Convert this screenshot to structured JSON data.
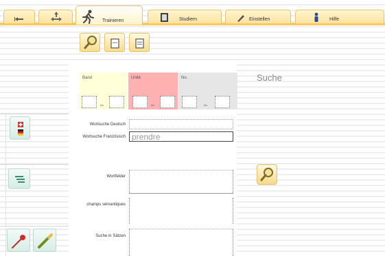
{
  "tabs": [
    {
      "id": "back",
      "label": "",
      "icon": "back-arrow-icon"
    },
    {
      "id": "move",
      "label": "",
      "icon": "move-arrows-icon"
    },
    {
      "id": "trainieren",
      "label": "Trainieren",
      "icon": "running-figure-icon",
      "active": true
    },
    {
      "id": "studieren",
      "label": "Studiern",
      "icon": "book-icon"
    },
    {
      "id": "einstellen",
      "label": "Einstellen",
      "icon": "pen-icon"
    },
    {
      "id": "hilfe",
      "label": "Hilfe",
      "icon": "info-icon"
    }
  ],
  "subtoolbar": [
    {
      "id": "search",
      "icon": "magnifier-icon"
    },
    {
      "id": "card",
      "icon": "card-icon"
    },
    {
      "id": "list",
      "icon": "list-icon"
    }
  ],
  "columns": [
    {
      "label": "Band",
      "color": "#ffffd8"
    },
    {
      "label": "Unité",
      "color": "#ffb0b0"
    },
    {
      "label": "No.",
      "color": "#e6e6e6"
    }
  ],
  "bis_label": "bis",
  "labels": {
    "wortsuche_deutsch": "Wortsuche Deutsch",
    "wortsuche_franzoesisch": "Wortsuche Französisch",
    "wortfelder": "Wortfelder",
    "champs_semantiques": "champs sémantiques",
    "suche_in_saetzen": "Suche in Sätzen"
  },
  "inputs": {
    "wortsuche_franzoesisch_value": "prendre"
  },
  "suche_title": "Suche",
  "icons": {
    "flags": "flags-icon",
    "wortfelder": "list-lines-icon",
    "pin": "pin-icon",
    "pencil": "pencil-icon",
    "search_action": "magnifier-icon"
  }
}
